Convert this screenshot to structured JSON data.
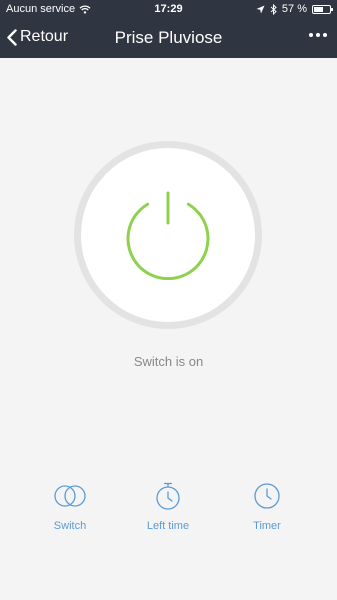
{
  "status_bar": {
    "carrier": "Aucun service",
    "time": "17:29",
    "battery_percent": "57 %",
    "battery_level": 0.57,
    "icons": [
      "wifi-icon",
      "location-arrow-icon",
      "bluetooth-icon",
      "battery-icon"
    ]
  },
  "nav": {
    "back_label": "Retour",
    "title": "Prise Pluviose",
    "more_icon": "more-icon"
  },
  "power": {
    "state_text": "Switch is on",
    "is_on": true,
    "accent_color": "#8fd14f"
  },
  "tabs": [
    {
      "label": "Switch",
      "icon": "switch-circles-icon"
    },
    {
      "label": "Left time",
      "icon": "stopwatch-icon"
    },
    {
      "label": "Timer",
      "icon": "clock-icon"
    }
  ],
  "colors": {
    "header_bg": "#2f3642",
    "background": "#f4f4f4",
    "tab_color": "#5b9bd5",
    "ring_color": "#e3e3e3"
  }
}
